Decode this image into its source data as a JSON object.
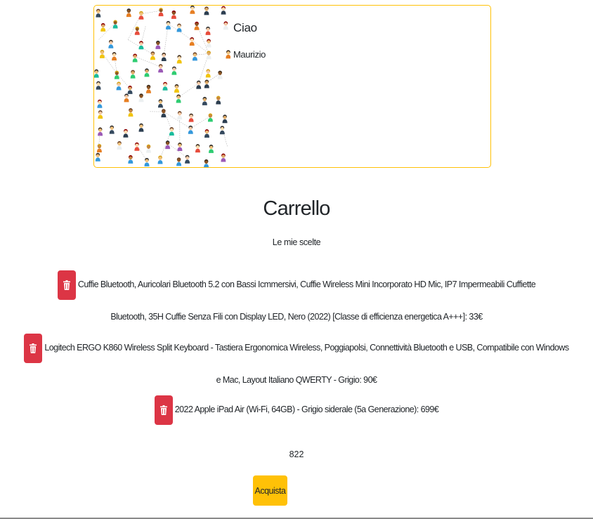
{
  "profile": {
    "greeting": "Ciao",
    "username": "Maurizio",
    "image_icon": "people-network-image"
  },
  "cart": {
    "title": "Carrello",
    "subtitle": "Le mie scelte",
    "delete_icon": "trash-icon",
    "items": [
      {
        "text": "Cuffie Bluetooth, Auricolari Bluetooth 5.2 con Bassi Icmmersivi, Cuffie Wireless Mini Incorporato HD Mic, IP7 Impermeabili Cuffiette Bluetooth, 35H Cuffie Senza Fili con Display LED, Nero (2022) [Classe di efficienza energetica A+++]: 33€"
      },
      {
        "text": "Logitech ERGO K860 Wireless Split Keyboard - Tastiera Ergonomica Wireless, Poggiapolsi, Connettività Bluetooth e USB, Compatibile con Windows e Mac, Layout Italiano QWERTY - Grigio: 90€"
      },
      {
        "text": "2022 Apple iPad Air (Wi-Fi, 64GB) - Grigio siderale (5a Generazione): 699€"
      }
    ],
    "total": "822",
    "buy_label": "Acquista"
  },
  "colors": {
    "accent": "#ffc107",
    "danger": "#dc3545"
  }
}
